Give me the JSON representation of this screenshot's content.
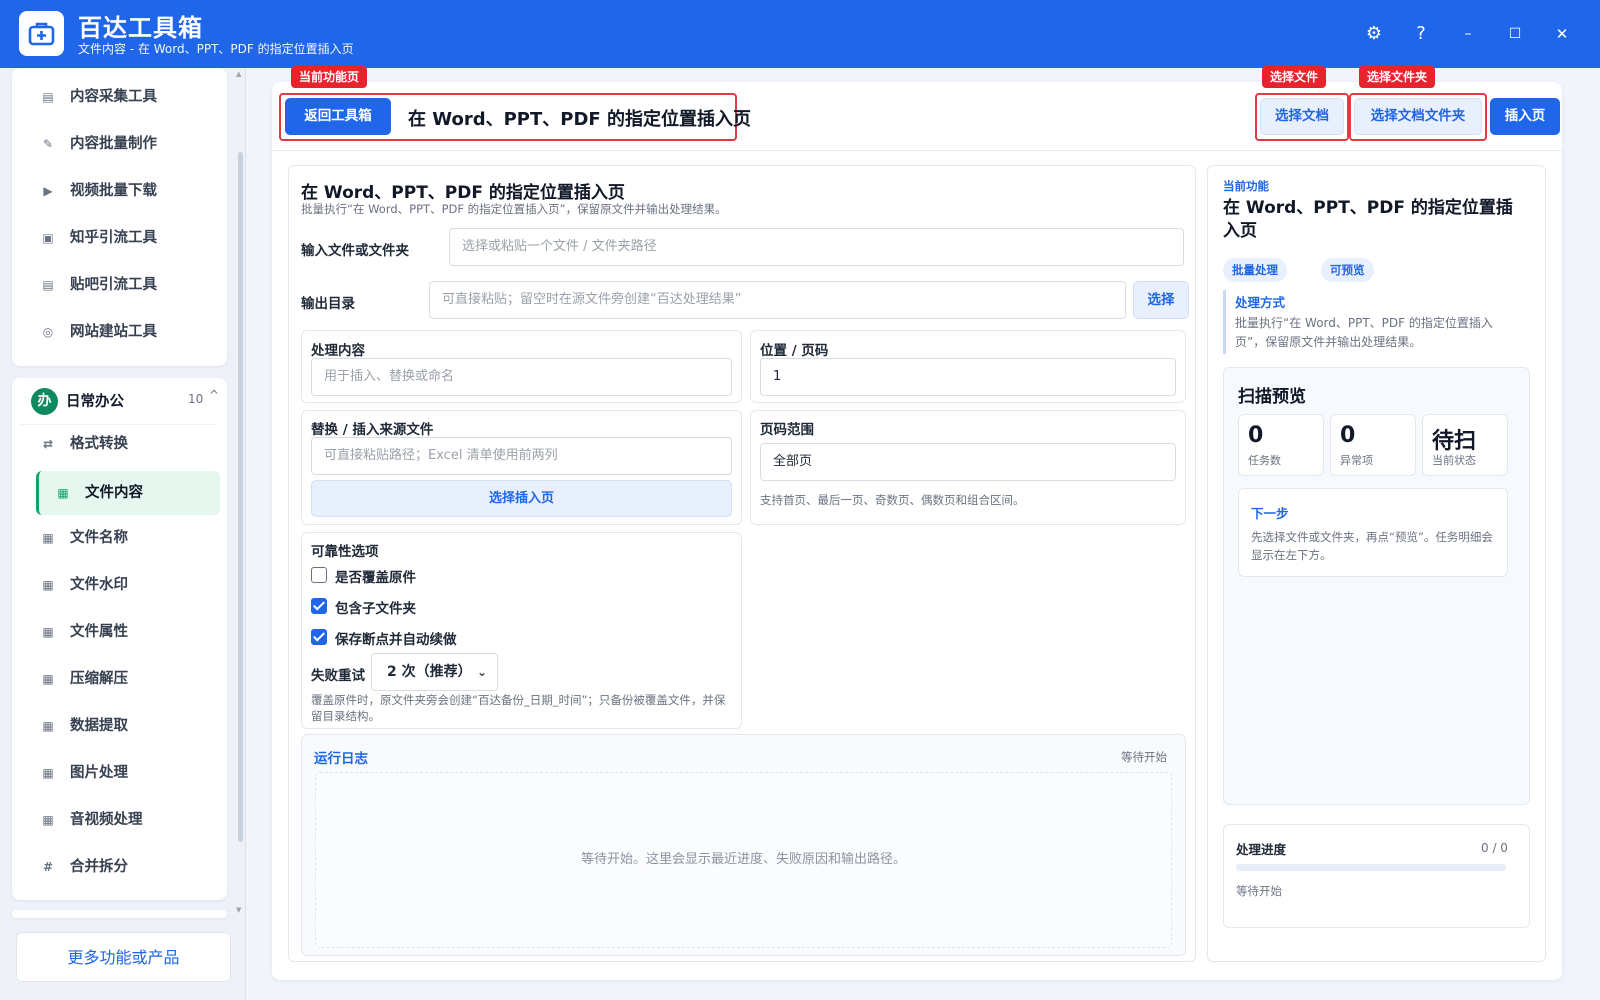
{
  "app": {
    "title": "百达工具箱",
    "subtitle": "文件内容 - 在 Word、PPT、PDF 的指定位置插入页",
    "controls": {
      "settings": "⚙",
      "help": "?",
      "minimize": "–",
      "maximize": "☐",
      "close": "✕"
    }
  },
  "sidebar": {
    "top_items": [
      {
        "label": "内容采集工具",
        "icon": "clipboard-icon"
      },
      {
        "label": "内容批量制作",
        "icon": "pencil-icon"
      },
      {
        "label": "视频批量下载",
        "icon": "video-icon"
      },
      {
        "label": "知乎引流工具",
        "icon": "zhihu-icon"
      },
      {
        "label": "贴吧引流工具",
        "icon": "tieba-icon"
      },
      {
        "label": "网站建站工具",
        "icon": "web-icon"
      }
    ],
    "group": {
      "badge": "办",
      "title": "日常办公",
      "count": "10",
      "caret": "^"
    },
    "group_items": [
      {
        "label": "格式转换",
        "icon": "swap-icon",
        "glyph": "⇄"
      },
      {
        "label": "文件内容",
        "icon": "grid-icon",
        "glyph": "▦",
        "active": true
      },
      {
        "label": "文件名称",
        "icon": "grid-icon",
        "glyph": "▦"
      },
      {
        "label": "文件水印",
        "icon": "grid-icon",
        "glyph": "▦"
      },
      {
        "label": "文件属性",
        "icon": "grid-icon",
        "glyph": "▦"
      },
      {
        "label": "压缩解压",
        "icon": "grid-icon",
        "glyph": "▦"
      },
      {
        "label": "数据提取",
        "icon": "grid-icon",
        "glyph": "▦"
      },
      {
        "label": "图片处理",
        "icon": "grid-icon",
        "glyph": "▦"
      },
      {
        "label": "音视频处理",
        "icon": "grid-icon",
        "glyph": "▦"
      },
      {
        "label": "合并拆分",
        "icon": "hash-icon",
        "glyph": "#"
      }
    ],
    "more_button": "更多功能或产品"
  },
  "toolbar": {
    "tag_current": "当前功能页",
    "back_button": "返回工具箱",
    "heading": "在 Word、PPT、PDF 的指定位置插入页",
    "tag_select_file": "选择文件",
    "tag_select_folder": "选择文件夹",
    "select_doc_button": "选择文档",
    "select_folder_button": "选择文档文件夹",
    "insert_button": "插入页"
  },
  "form": {
    "title": "在 Word、PPT、PDF 的指定位置插入页",
    "description": "批量执行“在 Word、PPT、PDF 的指定位置插入页”，保留原文件并输出处理结果。",
    "input_label": "输入文件或文件夹",
    "input_placeholder": "选择或粘贴一个文件 / 文件夹路径",
    "output_label": "输出目录",
    "output_placeholder": "可直接粘贴；留空时在源文件旁创建“百达处理结果”",
    "output_select_button": "选择",
    "content_label": "处理内容",
    "content_placeholder": "用于插入、替换或命名",
    "position_label": "位置 / 页码",
    "position_value": "1",
    "source_label": "替换 / 插入来源文件",
    "source_placeholder": "可直接粘贴路径；Excel 清单使用前两列",
    "source_select_button": "选择插入页",
    "range_label": "页码范围",
    "range_value": "全部页",
    "range_hint": "支持首页、最后一页、奇数页、偶数页和组合区间。",
    "reliability_label": "可靠性选项",
    "opt_overwrite": "是否覆盖原件",
    "opt_subfolders": "包含子文件夹",
    "opt_resume": "保存断点并自动续做",
    "retry_label": "失败重试",
    "retry_value": "2 次（推荐）",
    "reliability_hint": "覆盖原件时，原文件夹旁会创建“百达备份_日期_时间”；只备份被覆盖文件，并保留目录结构。",
    "log_title": "运行日志",
    "log_status": "等待开始",
    "log_empty": "等待开始。这里会显示最近进度、失败原因和输出路径。"
  },
  "side_info": {
    "current_label": "当前功能",
    "title": "在 Word、PPT、PDF 的指定位置插入页",
    "pill_batch": "批量处理",
    "pill_preview": "可预览",
    "method_title": "处理方式",
    "method_text": "批量执行“在 Word、PPT、PDF 的指定位置插入页”，保留原文件并输出处理结果。",
    "scan_title": "扫描预览",
    "stats": [
      {
        "value": "0",
        "label": "任务数"
      },
      {
        "value": "0",
        "label": "异常项"
      },
      {
        "value": "待扫",
        "label": "当前状态"
      }
    ],
    "next_title": "下一步",
    "next_text": "先选择文件或文件夹，再点“预览”。任务明细会显示在左下方。",
    "progress_title": "处理进度",
    "progress_count": "0 / 0",
    "progress_fraction": 0,
    "progress_status": "等待开始"
  },
  "colors": {
    "brand": "#1f66e8",
    "active_green": "#10a36a",
    "annotation_red": "#e8232e"
  }
}
